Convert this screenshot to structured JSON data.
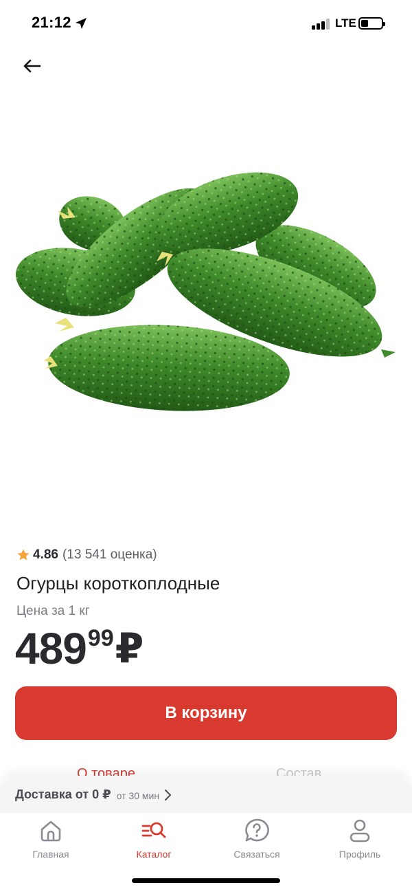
{
  "status_bar": {
    "time": "21:12",
    "network": "LTE"
  },
  "icons": {
    "back": "arrow-left-icon",
    "star": "star-icon",
    "chevron": "chevron-right-icon",
    "home": "home-icon",
    "catalog": "catalog-search-icon",
    "contact": "question-bubble-icon",
    "profile": "person-icon"
  },
  "product": {
    "rating": "4.86",
    "rating_count": "(13 541 оценка)",
    "title": "Огурцы короткоплодные",
    "price_unit": "Цена за 1 кг",
    "price_main": "489",
    "price_cents": "99",
    "currency": "₽",
    "add_to_cart": "В корзину"
  },
  "tabs": {
    "about": "О товаре",
    "composition": "Состав"
  },
  "delivery": {
    "text": "Доставка от 0 ₽",
    "time": "от 30 мин"
  },
  "nav": [
    {
      "label": "Главная",
      "active": false
    },
    {
      "label": "Каталог",
      "active": true
    },
    {
      "label": "Связаться",
      "active": false
    },
    {
      "label": "Профиль",
      "active": false
    }
  ],
  "colors": {
    "accent": "#d93a30",
    "text": "#1f1f24",
    "muted": "#7b7b85",
    "star": "#f2a33a",
    "cucumber_dark": "#2c6e1e",
    "cucumber_light": "#6fb24a"
  }
}
